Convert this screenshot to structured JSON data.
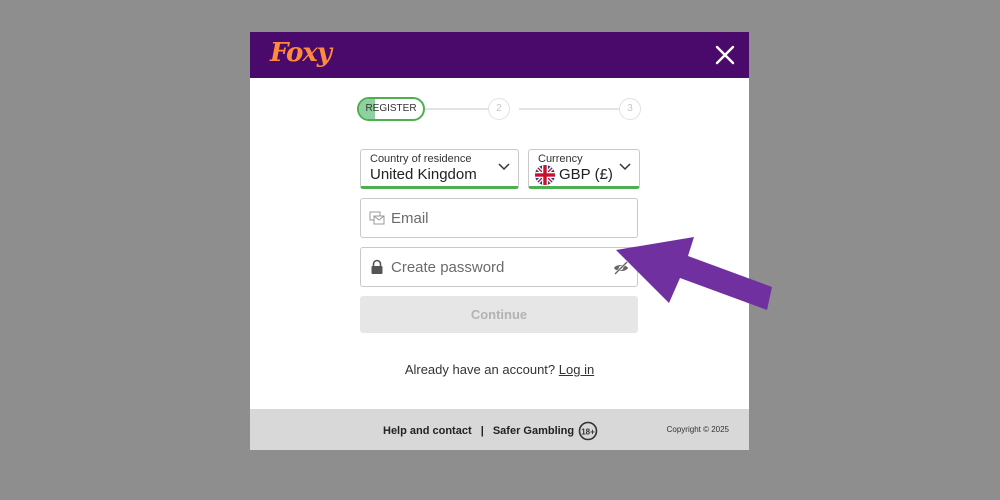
{
  "header": {
    "logo_text": "Foxy",
    "close_icon": "close-icon"
  },
  "stepper": {
    "active_label": "REGISTER",
    "step2": "2",
    "step3": "3"
  },
  "country": {
    "label": "Country of residence",
    "value": "United Kingdom"
  },
  "currency": {
    "label": "Currency",
    "value": "GBP (£)",
    "flag_icon": "uk-flag-icon"
  },
  "email": {
    "placeholder": "Email",
    "icon": "email-icon"
  },
  "password": {
    "placeholder": "Create password",
    "icon": "lock-icon",
    "toggle_icon": "eye-slash-icon"
  },
  "continue_label": "Continue",
  "login_prompt": {
    "text": "Already have an account?",
    "link": "Log in"
  },
  "footer": {
    "help": "Help and contact",
    "separator": "|",
    "safer": "Safer Gambling",
    "age_badge": "18+",
    "copyright": "Copyright © 2025"
  },
  "colors": {
    "header_bg": "#4a0a6b",
    "accent_green": "#4caf50",
    "arrow": "#7030a0",
    "logo": "#ff8a3d"
  }
}
